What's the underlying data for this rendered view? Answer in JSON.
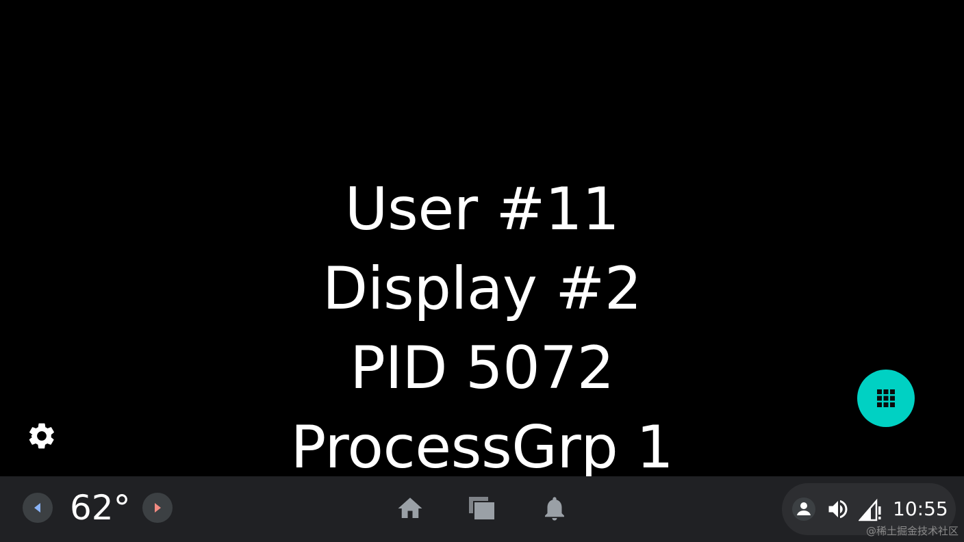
{
  "display_info": {
    "user": "User #11",
    "display": "Display #2",
    "pid": "PID 5072",
    "process_group": "ProcessGrp 1"
  },
  "icons": {
    "settings": "gear-icon",
    "app_grid": "grid-icon",
    "temp_down": "chevron-left-icon",
    "temp_up": "chevron-right-icon",
    "home": "home-icon",
    "recents": "recents-icon",
    "notifications": "bell-icon",
    "user": "user-icon",
    "volume": "volume-icon",
    "signal": "signal-icon"
  },
  "navbar": {
    "temperature": "62°"
  },
  "status": {
    "time": "10:55"
  },
  "watermark": "@稀土掘金技术社区",
  "colors": {
    "background": "#000000",
    "navbar": "#202124",
    "accent": "#00d1c3",
    "temp_down_arrow": "#8ab4f8",
    "temp_up_arrow": "#f28b82"
  }
}
